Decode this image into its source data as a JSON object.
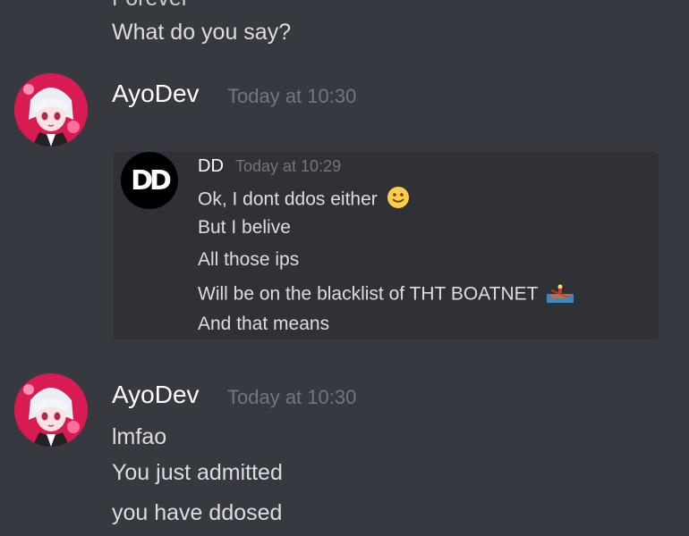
{
  "top_message": {
    "partial_line": "Forever",
    "text": "What do you say?"
  },
  "messages": [
    {
      "author": "AyoDev",
      "timestamp": "Today at 10:30",
      "avatar_icon": "anime-avatar-icon",
      "quote": {
        "author": "DD",
        "timestamp": "Today at 10:29",
        "avatar_text": "DD",
        "lines": [
          {
            "text": "Ok, I dont ddos either",
            "emoji": "slight-smile-emoji"
          },
          {
            "text": "But I belive"
          },
          {
            "text": "All those ips"
          },
          {
            "text": "Will be on the blacklist of THT BOATNET",
            "emoji": "rowboat-emoji"
          },
          {
            "text": "And that means"
          }
        ]
      }
    },
    {
      "author": "AyoDev",
      "timestamp": "Today at 10:30",
      "avatar_icon": "anime-avatar-icon",
      "lines": [
        "lmfao",
        "You just admitted",
        "you have ddosed"
      ]
    }
  ],
  "colors": {
    "background": "#36393f",
    "embed_background": "#2f3136",
    "username": "#ffffff",
    "timestamp": "#72767d",
    "text": "#dcddde",
    "avatar_accent": "#d81b50"
  }
}
